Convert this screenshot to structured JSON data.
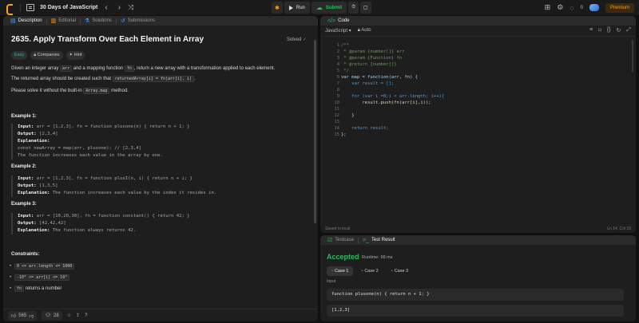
{
  "topbar": {
    "title": "30 Days of JavaScript",
    "run_label": "Run",
    "submit_label": "Submit",
    "streak": "0",
    "premium_label": "Premium"
  },
  "left_tabs": {
    "description": "Description",
    "editorial": "Editorial",
    "solutions": "Solutions",
    "submissions": "Submissions"
  },
  "problem": {
    "title": "2635. Apply Transform Over Each Element in Array",
    "solved": "Solved",
    "difficulty": "Easy",
    "companies": "Companies",
    "hint": "Hint",
    "p1_a": "Given an integer array",
    "p1_code1": "arr",
    "p1_b": "and a mapping function",
    "p1_code2": "fn",
    "p1_c": ", return a new array with a transformation applied to each element.",
    "p2_a": "The returned array should be created such that",
    "p2_code": "returnedArray[i] = fn(arr[i], i)",
    "p2_b": ".",
    "p3_a": "Please solve it without the built-in",
    "p3_code": "Array.map",
    "p3_b": "method."
  },
  "examples": [
    {
      "title": "Example 1:",
      "input": "arr = [1,2,3], fn = function plusone(n) { return n + 1; }",
      "output": "[2,3,4]",
      "explanation_label": "Explanation:",
      "explanation": "",
      "extra1": "const newArray = map(arr, plusone); // [2,3,4]",
      "extra2": "The function increases each value in the array by one."
    },
    {
      "title": "Example 2:",
      "input": "arr = [1,2,3], fn = function plusI(n, i) { return n + i; }",
      "output": "[1,3,5]",
      "explanation_label": "Explanation:",
      "explanation": "The function increases each value by the index it resides in."
    },
    {
      "title": "Example 3:",
      "input": "arr = [10,20,30], fn = function constant() { return 42; }",
      "output": "[42,42,42]",
      "explanation_label": "Explanation:",
      "explanation": "The function always returns 42."
    }
  ],
  "labels": {
    "input": "Input:",
    "output": "Output:"
  },
  "constraints": {
    "title": "Constraints:",
    "c1": "0 <= arr.length <= 1000",
    "c2": "-10⁹ <= arr[i] <= 10⁹",
    "c3_code": "fn",
    "c3": "returns a number"
  },
  "footer": {
    "likes": "565",
    "comments": "28"
  },
  "code_panel": {
    "tab": "Code",
    "language": "JavaScript",
    "auto": "Auto",
    "saved": "Saved to local",
    "cursor": "Ln 14, Col 19"
  },
  "code_lines": [
    "/**",
    " * @param {number[]} arr",
    " * @param {Function} fn",
    " * @return {number[]}",
    " */",
    "var map = function(arr, fn) {",
    "    var result = [];",
    "",
    "    for (var i =0;i < arr.length; i++){",
    "        result.push(fn(arr[i],i));",
    "",
    "    }",
    "",
    "    return result;",
    "};"
  ],
  "test_panel": {
    "testcase_tab": "Testcase",
    "result_tab": "Test Result",
    "status": "Accepted",
    "runtime": "Runtime: 98 ms",
    "cases": [
      "Case 1",
      "Case 2",
      "Case 3"
    ],
    "input_label": "Input",
    "input_fn": "function plusone(n) { return n + 1; }",
    "input_arr": "[1,2,3]"
  }
}
